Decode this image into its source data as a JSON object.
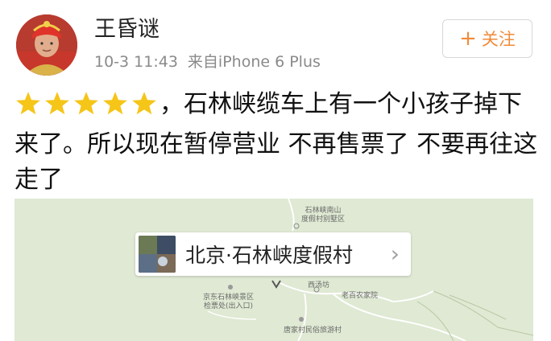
{
  "user": {
    "name": "王昏谜",
    "time": "10-3 11:43",
    "source": "来自iPhone 6 Plus"
  },
  "follow_button": {
    "plus": "+",
    "label": "关注"
  },
  "post": {
    "rating_stars": 5,
    "text": "，石林峡缆车上有一个小孩子掉下来了。所以现在暂停营业 不再售票了 不要再往这走了"
  },
  "location": {
    "name": "北京·石林峡度假村",
    "chevron": "›"
  },
  "map": {
    "labels": {
      "label_top_line1": "石林峡南山",
      "label_top_line2": "度假村别墅区",
      "label_left_line1": "京东石林峡景区",
      "label_left_line2": "检票处(出入口)",
      "label_mid": "西汤坊",
      "label_right": "老百农家院",
      "label_bottom": "唐家村民俗旅游村"
    }
  },
  "colors": {
    "accent": "#f08b3a",
    "star": "#f5c518",
    "map_background": "#dfe9d3",
    "meta_text": "#8a8a8a"
  }
}
